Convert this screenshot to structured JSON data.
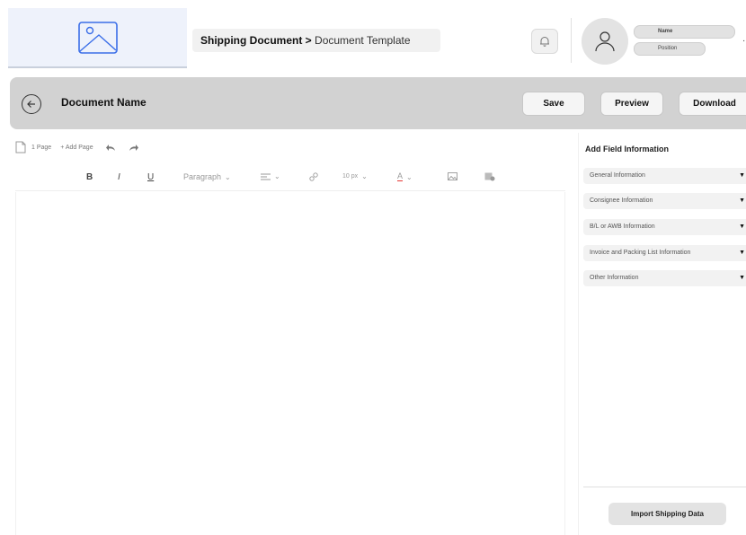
{
  "header": {
    "logo_icon": "image-placeholder-icon",
    "breadcrumb": {
      "section": "Shipping Document",
      "separator": ">",
      "page": "Document Template"
    },
    "notification_icon": "bell-icon",
    "user": {
      "avatar_icon": "user-icon",
      "name_label": "Name",
      "position_label": "Position"
    }
  },
  "toolbar": {
    "back_icon": "arrow-left-circle-icon",
    "document_name": "Document Name",
    "save_label": "Save",
    "preview_label": "Preview",
    "download_label": "Download"
  },
  "pages": {
    "count_label": "1 Page",
    "add_label": "+ Add Page"
  },
  "format_toolbar": {
    "bold": "B",
    "italic": "I",
    "underline": "U",
    "paragraph_style": "Paragraph",
    "font_size": "10 px",
    "text_color_label": "A",
    "text_color": "#e53935"
  },
  "side_panel": {
    "title": "Add  Field Information",
    "sections": [
      {
        "label": "General Information"
      },
      {
        "label": "Consignee Information"
      },
      {
        "label": "B/L or AWB Information"
      },
      {
        "label": "Invoice and Packing List Information"
      },
      {
        "label": "Other Information"
      }
    ],
    "import_label": "Import Shipping Data"
  },
  "colors": {
    "accent": "#3a6ee8",
    "toolbar_bg": "#d2d2d2",
    "logo_bg": "#eef2fb"
  }
}
